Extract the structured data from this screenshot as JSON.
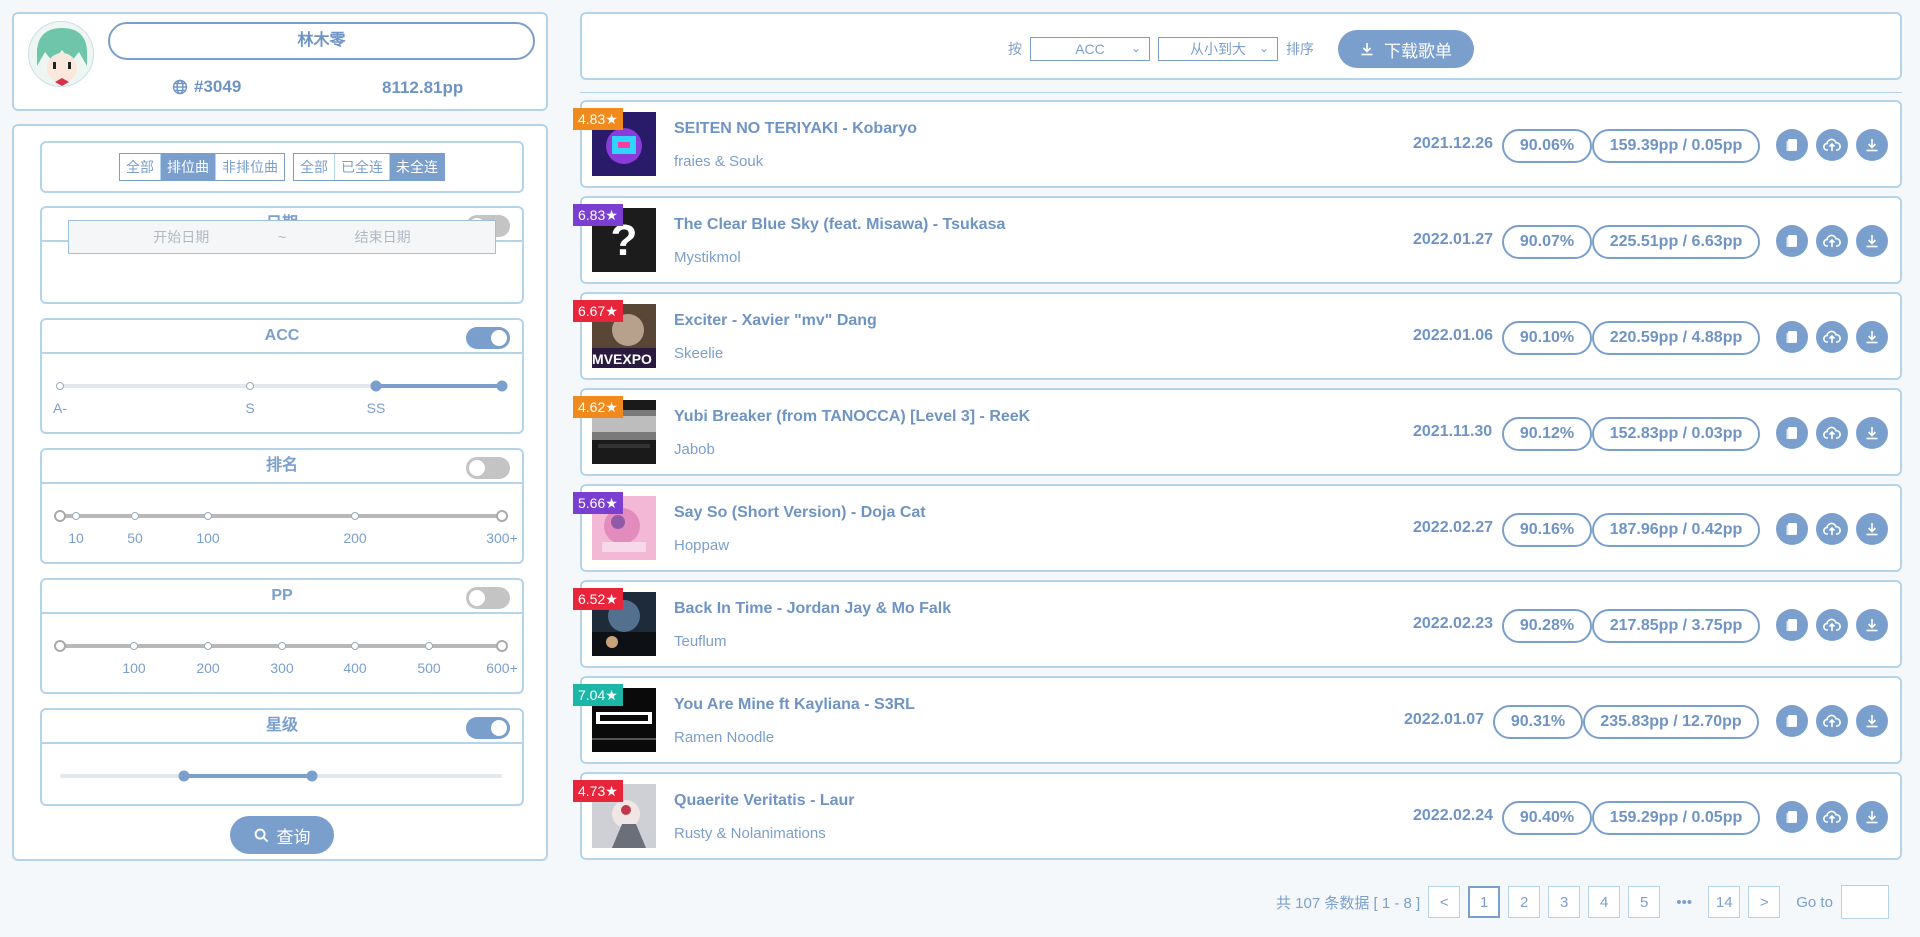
{
  "profile": {
    "name": "林木零",
    "rank": "#3049",
    "pp": "8112.81pp"
  },
  "filters": {
    "type_tabs": [
      "全部",
      "排位曲",
      "非排位曲"
    ],
    "type_active": 1,
    "fc_tabs": [
      "全部",
      "已全连",
      "未全连"
    ],
    "fc_active": 2,
    "date": {
      "label": "日期",
      "enabled": false,
      "start_placeholder": "开始日期",
      "separator": "~",
      "end_placeholder": "结束日期"
    },
    "acc": {
      "label": "ACC",
      "enabled": true,
      "ticks": [
        "A-",
        "S",
        "SS"
      ],
      "range": [
        "SS",
        "SS+"
      ]
    },
    "rank": {
      "label": "排名",
      "enabled": false,
      "ticks": [
        "10",
        "50",
        "100",
        "200",
        "300+"
      ]
    },
    "pp": {
      "label": "PP",
      "enabled": false,
      "ticks": [
        "100",
        "200",
        "300",
        "400",
        "500",
        "600+"
      ]
    },
    "stars": {
      "label": "星级",
      "enabled": true,
      "range_fraction": [
        0.28,
        0.57
      ]
    },
    "query_label": "查询"
  },
  "toolbar": {
    "sort_prefix": "按",
    "sort_field": "ACC",
    "sort_order": "从小到大",
    "sort_suffix": "排序",
    "download_label": "下载歌单"
  },
  "songs": [
    {
      "stars": "4.83★",
      "star_color": "#f08a1c",
      "title": "SEITEN NO TERIYAKI - Kobaryo",
      "mapper": "fraies & Souk",
      "date": "2021.12.26",
      "acc": "90.06%",
      "pp": "159.39pp / 0.05pp"
    },
    {
      "stars": "6.83★",
      "star_color": "#7a3fd0",
      "title": "The Clear Blue Sky (feat. Misawa) - Tsukasa",
      "mapper": "Mystikmol",
      "date": "2022.01.27",
      "acc": "90.07%",
      "pp": "225.51pp / 6.63pp"
    },
    {
      "stars": "6.67★",
      "star_color": "#e8253b",
      "title": "Exciter - Xavier \"mv\" Dang",
      "mapper": "Skeelie",
      "date": "2022.01.06",
      "acc": "90.10%",
      "pp": "220.59pp / 4.88pp"
    },
    {
      "stars": "4.62★",
      "star_color": "#f08a1c",
      "title": "Yubi Breaker (from TANOCCA) [Level 3] - ReeK",
      "mapper": "Jabob",
      "date": "2021.11.30",
      "acc": "90.12%",
      "pp": "152.83pp / 0.03pp"
    },
    {
      "stars": "5.66★",
      "star_color": "#7a3fd0",
      "title": "Say So (Short Version) - Doja Cat",
      "mapper": "Hoppaw",
      "date": "2022.02.27",
      "acc": "90.16%",
      "pp": "187.96pp / 0.42pp"
    },
    {
      "stars": "6.52★",
      "star_color": "#e8253b",
      "title": "Back In Time - Jordan Jay & Mo Falk",
      "mapper": "Teuflum",
      "date": "2022.02.23",
      "acc": "90.28%",
      "pp": "217.85pp / 3.75pp"
    },
    {
      "stars": "7.04★",
      "star_color": "#1bb6a5",
      "title": "You Are Mine ft Kayliana - S3RL",
      "mapper": "Ramen Noodle",
      "date": "2022.01.07",
      "acc": "90.31%",
      "pp": "235.83pp / 12.70pp"
    },
    {
      "stars": "4.73★",
      "star_color": "#e8253b",
      "title": "Quaerite Veritatis - Laur",
      "mapper": "Rusty & Nolanimations",
      "date": "2022.02.24",
      "acc": "90.40%",
      "pp": "159.29pp / 0.05pp"
    }
  ],
  "pagination": {
    "summary": "共 107 条数据 [ 1 - 8 ]",
    "pages": [
      "1",
      "2",
      "3",
      "4",
      "5"
    ],
    "active": "1",
    "ellipsis": "•••",
    "last": "14",
    "prev": "<",
    "next": ">",
    "goto_label": "Go to"
  },
  "colors": {
    "accent": "#7b9fcc",
    "border": "#b3d4ea",
    "background": "#f5f8fb"
  }
}
